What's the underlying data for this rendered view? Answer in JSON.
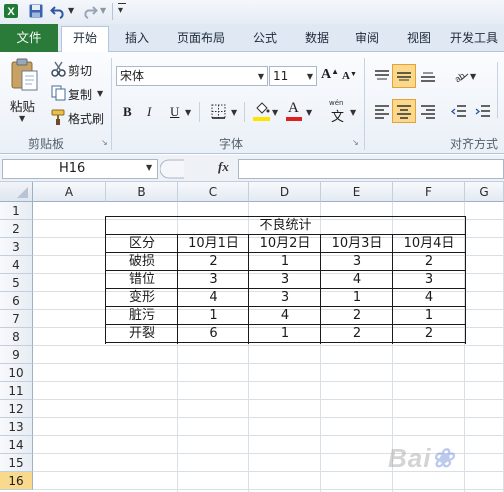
{
  "colors": {
    "file_tab_bg": "#2a7a3a",
    "selected_row_header": "#f9d98c",
    "ribbon_bg": "#eaf0f7",
    "fill_color_bar": "#ffe400",
    "font_color_bar": "#e02020"
  },
  "quick_access": {
    "icons": [
      "excel-app-icon",
      "save-icon",
      "undo-icon",
      "redo-icon",
      "customize-qat-icon"
    ]
  },
  "tabs": {
    "file": "文件",
    "home": "开始",
    "insert": "插入",
    "page_layout": "页面布局",
    "formulas": "公式",
    "data": "数据",
    "review": "审阅",
    "view": "视图",
    "developer": "开发工具"
  },
  "ribbon": {
    "clipboard": {
      "group_label": "剪贴板",
      "paste": "粘贴",
      "cut": "剪切",
      "copy": "复制",
      "format_painter": "格式刷"
    },
    "font": {
      "group_label": "字体",
      "font_name": "宋体",
      "font_size": "11",
      "bold": "B",
      "italic": "I",
      "underline": "U",
      "font_color_letter": "A",
      "wen_label": "wén",
      "wen_char": "文"
    },
    "alignment": {
      "group_label": "对齐方式"
    }
  },
  "formula_bar": {
    "name_box": "H16",
    "fx": "fx",
    "value": ""
  },
  "sheet": {
    "columns": [
      "A",
      "B",
      "C",
      "D",
      "E",
      "F",
      "G"
    ],
    "rows": [
      "1",
      "2",
      "3",
      "4",
      "5",
      "6",
      "7",
      "8",
      "9",
      "10",
      "11",
      "12",
      "13",
      "14",
      "15",
      "16"
    ],
    "selected_row": "16"
  },
  "table": {
    "title": "不良统计",
    "header": [
      "区分",
      "10月1日",
      "10月2日",
      "10月3日",
      "10月4日"
    ],
    "rows": [
      [
        "破损",
        "2",
        "1",
        "3",
        "2"
      ],
      [
        "错位",
        "3",
        "3",
        "4",
        "3"
      ],
      [
        "变形",
        "4",
        "3",
        "1",
        "4"
      ],
      [
        "脏污",
        "1",
        "4",
        "2",
        "1"
      ],
      [
        "开裂",
        "6",
        "1",
        "2",
        "2"
      ]
    ]
  }
}
